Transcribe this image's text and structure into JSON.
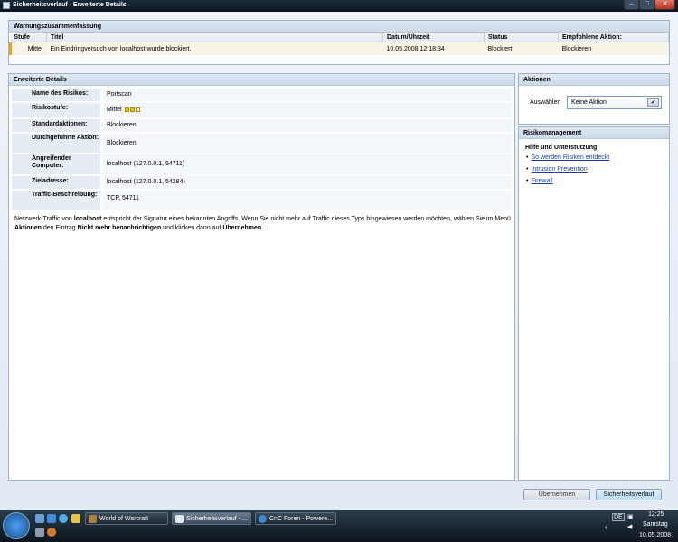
{
  "window": {
    "title": "Sicherheitsverlauf - Erweiterte Details",
    "min": "–",
    "max": "□",
    "close": "✕"
  },
  "summary": {
    "heading": "Warnungszusammenfassung",
    "columns": [
      "Stufe",
      "Titel",
      "Datum/Uhrzeit",
      "Status",
      "Empfohlene Aktion:"
    ],
    "row": [
      "Mittel",
      "Ein Eindringversuch von localhost wurde blockiert.",
      "10.05.2008 12:18:34",
      "Blockiert",
      "Blockieren"
    ]
  },
  "details": {
    "heading": "Erweiterte Details",
    "rows": [
      {
        "label": "Name des Risikos:",
        "value": "Portscan"
      },
      {
        "label": "Risikostufe:",
        "value": "Mittel"
      },
      {
        "label": "Standardaktionen:",
        "value": "Blockieren"
      },
      {
        "label": "Durchgeführte Aktion:",
        "value": "Blockieren"
      },
      {
        "label": "Angreifender Computer:",
        "value": "localhost (127.0.0.1, 54711)"
      },
      {
        "label": "Zieladresse:",
        "value": "localhost (127.0.0.1, 54284)"
      },
      {
        "label": "Traffic-Beschreibung:",
        "value": "TCP, 54711"
      }
    ],
    "risk_level_indicator": {
      "filled": 2,
      "total": 3,
      "color": "#f2c500"
    },
    "description": {
      "t1": "Netzwerk-Traffic von ",
      "b1": "localhost",
      "t2": " entspricht der Signatur eines bekannten Angriffs. Wenn Sie nicht mehr auf Traffic dieses Typs hingewiesen werden möchten, wählen Sie im Menü ",
      "b2": "Aktionen",
      "t3": " den Eintrag ",
      "b3": "Nicht mehr benachrichtigen",
      "t4": " und klicken dann auf ",
      "b4": "Übernehmen",
      "t5": "."
    }
  },
  "actions": {
    "heading": "Aktionen",
    "select_label": "Auswählen",
    "selected": "Keine Aktion"
  },
  "risk": {
    "heading": "Risikomanagement",
    "subheading": "Hilfe und Unterstützung",
    "links": [
      "So werden Risiken entdeckt",
      "Intrusion Prevention",
      "Firewall"
    ]
  },
  "buttons": {
    "apply": "Übernehmen",
    "history": "Sicherheitsverlauf"
  },
  "taskbar": {
    "tasks": [
      "World of Warcraft",
      "Sicherheitsverlauf - ...",
      "CnC Foren - Powere..."
    ],
    "time": "12:25",
    "day": "Samstag",
    "date": "10.05.2008",
    "lang": "DE"
  },
  "colors": {
    "accent_warning": "#f0a020",
    "link": "#1b3fa8"
  }
}
